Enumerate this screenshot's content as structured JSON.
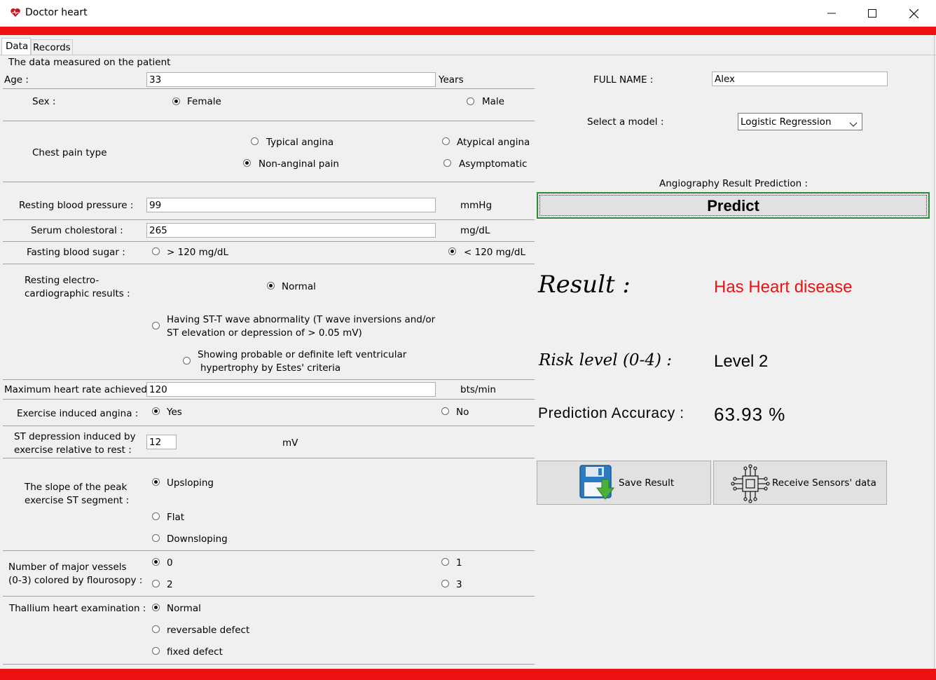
{
  "window": {
    "title": "Doctor heart",
    "minimize": "—",
    "maximize": "☐",
    "close": "✕",
    "app_icon": "heart-icon"
  },
  "tabs": [
    {
      "label": "Data",
      "active": true
    },
    {
      "label": "Records",
      "active": false
    }
  ],
  "group_title": "The data measured on the patient",
  "age": {
    "label": "Age :",
    "value": "33",
    "unit": "Years"
  },
  "sex": {
    "label": "Sex :",
    "options": [
      "Female",
      "Male"
    ],
    "selected": "Female"
  },
  "chest_pain": {
    "label": "Chest pain type",
    "options": [
      "Typical angina",
      "Atypical angina",
      "Non-anginal pain",
      "Asymptomatic"
    ],
    "selected": "Non-anginal pain"
  },
  "resting_bp": {
    "label": "Resting blood pressure :",
    "value": "99",
    "unit": "mmHg"
  },
  "cholesterol": {
    "label": "Serum cholestoral :",
    "value": "265",
    "unit": "mg/dL"
  },
  "fasting_sugar": {
    "label": "Fasting blood sugar :",
    "options": [
      "> 120 mg/dL",
      "< 120 mg/dL"
    ],
    "selected": "< 120 mg/dL"
  },
  "ecg": {
    "label_line1": "Resting electro-",
    "label_line2": "cardiographic results :",
    "opt_normal": "Normal",
    "opt_st_line1": "Having ST-T wave abnormality (T wave inversions and/or",
    "opt_st_line2": "ST elevation or depression of > 0.05 mV)",
    "opt_lvh_line1": "Showing probable or definite left ventricular",
    "opt_lvh_line2": "hypertrophy by Estes' criteria",
    "selected": "Normal"
  },
  "max_hr": {
    "label": "Maximum heart rate achieved",
    "value": "120",
    "unit": "bts/min"
  },
  "exercise_angina": {
    "label": "Exercise induced angina :",
    "options": [
      "Yes",
      "No"
    ],
    "selected": "Yes"
  },
  "st_depression": {
    "label_line1": "ST depression induced by",
    "label_line2": "exercise relative to rest :",
    "value": "12",
    "unit": "mV"
  },
  "slope": {
    "label_line1": "The slope of the peak",
    "label_line2": "exercise ST segment :",
    "options": [
      "Upsloping",
      "Flat",
      "Downsloping"
    ],
    "selected": "Upsloping"
  },
  "vessels": {
    "label_line1": "Number of major vessels",
    "label_line2": "(0-3) colored by flourosopy :",
    "options": [
      "0",
      "1",
      "2",
      "3"
    ],
    "selected": "0"
  },
  "thallium": {
    "label": "Thallium heart examination :",
    "options": [
      "Normal",
      "reversable defect",
      "fixed defect"
    ],
    "selected": "Normal"
  },
  "right": {
    "full_name_label": "FULL NAME :",
    "full_name_value": "Alex",
    "model_label": "Select a model :",
    "model_value": "Logistic Regression",
    "angiography_label": "Angiography Result Prediction :",
    "predict_label": "Predict",
    "result_label": "Result :",
    "result_value": "Has Heart disease",
    "risk_label": "Risk level (0-4) :",
    "risk_value": "Level 2",
    "accuracy_label": "Prediction Accuracy :",
    "accuracy_value": "63.93 %",
    "save_label": "Save Result",
    "sensors_label": "Receive Sensors' data"
  },
  "colors": {
    "accent_red": "#ee1111",
    "result_red": "#ee1111",
    "predict_border": "#2e8b3a"
  }
}
